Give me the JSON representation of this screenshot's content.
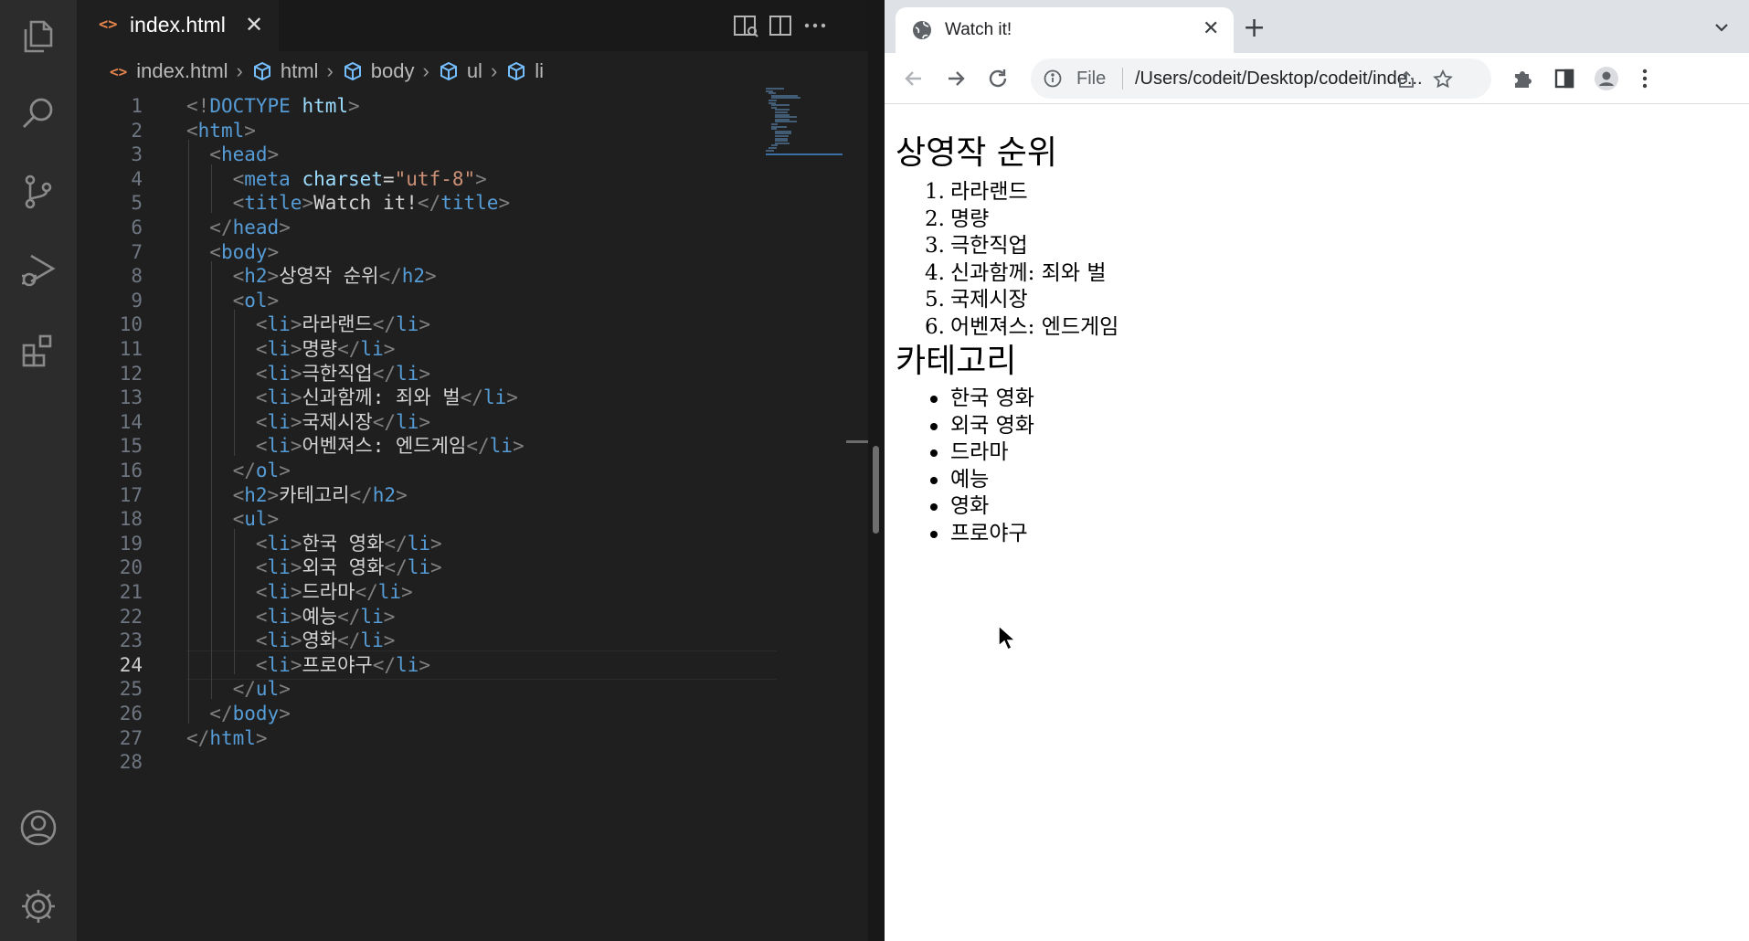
{
  "vscode": {
    "tab": {
      "label": "index.html",
      "glyph": "<>",
      "close": "✕"
    },
    "breadcrumb": [
      "index.html",
      "html",
      "body",
      "ul",
      "li"
    ],
    "current_line": 24,
    "code_lines": [
      "<!DOCTYPE html>",
      "<html>",
      "  <head>",
      "    <meta charset=\"utf-8\">",
      "    <title>Watch it!</title>",
      "  </head>",
      "  <body>",
      "    <h2>상영작 순위</h2>",
      "    <ol>",
      "      <li>라라랜드</li>",
      "      <li>명량</li>",
      "      <li>극한직업</li>",
      "      <li>신과함께: 죄와 벌</li>",
      "      <li>국제시장</li>",
      "      <li>어벤져스: 엔드게임</li>",
      "    </ol>",
      "    <h2>카테고리</h2>",
      "    <ul>",
      "      <li>한국 영화</li>",
      "      <li>외국 영화</li>",
      "      <li>드라마</li>",
      "      <li>예능</li>",
      "      <li>영화</li>",
      "      <li>프로야구</li>",
      "    </ul>",
      "  </body>",
      "</html>",
      ""
    ],
    "line_numbers": [
      "1",
      "2",
      "3",
      "4",
      "5",
      "6",
      "7",
      "8",
      "9",
      "10",
      "11",
      "12",
      "13",
      "14",
      "15",
      "16",
      "17",
      "18",
      "19",
      "20",
      "21",
      "22",
      "23",
      "24",
      "25",
      "26",
      "27",
      "28"
    ],
    "icons": [
      "explorer-icon",
      "search-icon",
      "source-control-icon",
      "run-debug-icon",
      "extensions-icon",
      "account-icon",
      "settings-gear-icon"
    ]
  },
  "chrome": {
    "tab_title": "Watch it!",
    "tab_close": "✕",
    "new_tab": "+",
    "scheme": "File",
    "url": "/Users/codeit/Desktop/codeit/inde..."
  },
  "page": {
    "h2_ranking": "상영작 순위",
    "ranking": [
      {
        "num": "1.",
        "text": "라라랜드"
      },
      {
        "num": "2.",
        "text": "명량"
      },
      {
        "num": "3.",
        "text": "극한직업"
      },
      {
        "num": "4.",
        "text": "신과함께: 죄와 벌"
      },
      {
        "num": "5.",
        "text": "국제시장"
      },
      {
        "num": "6.",
        "text": "어벤져스: 엔드게임"
      }
    ],
    "h2_category": "카테고리",
    "categories": [
      "한국 영화",
      "외국 영화",
      "드라마",
      "예능",
      "영화",
      "프로야구"
    ]
  },
  "colors": {
    "keyword_blue": "#569cd6",
    "attr": "#9cdcfe",
    "string": "#ce9178",
    "html_icon": "#e8854c"
  }
}
